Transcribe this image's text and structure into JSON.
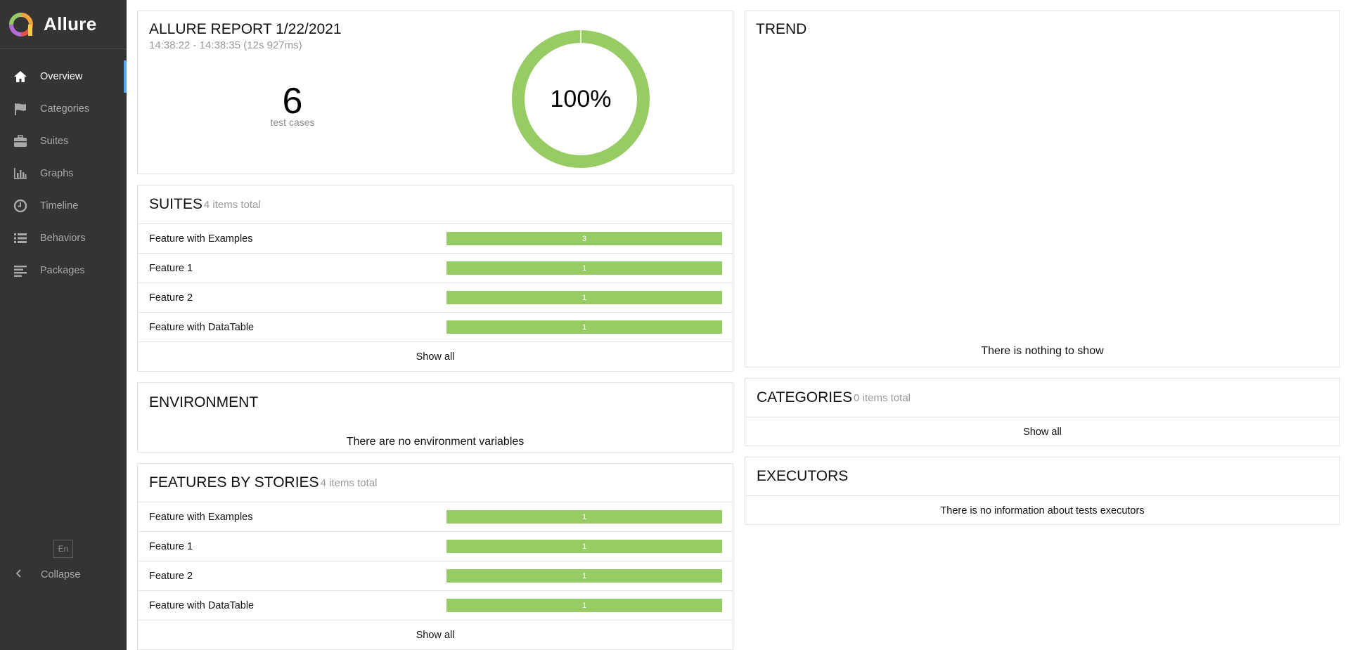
{
  "app": {
    "name": "Allure"
  },
  "sidebar": {
    "items": [
      {
        "label": "Overview",
        "icon": "home-icon",
        "active": true
      },
      {
        "label": "Categories",
        "icon": "flag-icon",
        "active": false
      },
      {
        "label": "Suites",
        "icon": "briefcase-icon",
        "active": false
      },
      {
        "label": "Graphs",
        "icon": "bar-chart-icon",
        "active": false
      },
      {
        "label": "Timeline",
        "icon": "clock-icon",
        "active": false
      },
      {
        "label": "Behaviors",
        "icon": "list-icon",
        "active": false
      },
      {
        "label": "Packages",
        "icon": "align-left-icon",
        "active": false
      }
    ],
    "language": "En",
    "collapse_label": "Collapse"
  },
  "summary": {
    "title": "ALLURE REPORT 1/22/2021",
    "time": "14:38:22 - 14:38:35 (12s 927ms)",
    "total": "6",
    "total_label": "test cases",
    "percent_label": "100%",
    "pass_rate": 1.0
  },
  "suites": {
    "title": "SUITES",
    "count_label": "4 items total",
    "rows": [
      {
        "name": "Feature with Examples",
        "count": "3"
      },
      {
        "name": "Feature 1",
        "count": "1"
      },
      {
        "name": "Feature 2",
        "count": "1"
      },
      {
        "name": "Feature with DataTable",
        "count": "1"
      }
    ],
    "show_all": "Show all"
  },
  "environment": {
    "title": "ENVIRONMENT",
    "empty": "There are no environment variables"
  },
  "features": {
    "title": "FEATURES BY STORIES",
    "count_label": "4 items total",
    "rows": [
      {
        "name": "Feature with Examples",
        "count": "1"
      },
      {
        "name": "Feature 1",
        "count": "1"
      },
      {
        "name": "Feature 2",
        "count": "1"
      },
      {
        "name": "Feature with DataTable",
        "count": "1"
      }
    ],
    "show_all": "Show all"
  },
  "trend": {
    "title": "TREND",
    "empty": "There is nothing to show"
  },
  "categories": {
    "title": "CATEGORIES",
    "count_label": "0 items total",
    "show_all": "Show all"
  },
  "executors": {
    "title": "EXECUTORS",
    "empty": "There is no information about tests executors"
  },
  "colors": {
    "sidebar_bg": "#343434",
    "active_accent": "#58a7ed",
    "passed": "#97cc64"
  }
}
